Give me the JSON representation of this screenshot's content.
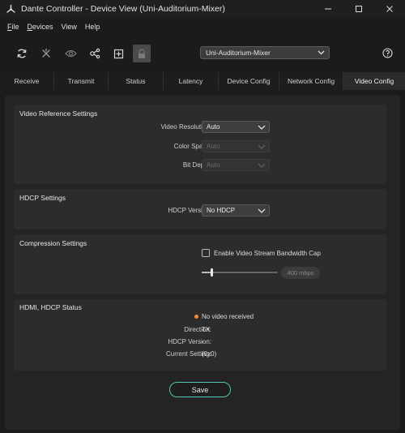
{
  "window": {
    "title": "Dante Controller - Device View (Uni-Auditorium-Mixer)",
    "icons": {
      "logo": "dante-logo-icon",
      "minimize": "minimize-icon",
      "maximize": "maximize-icon",
      "close": "close-icon"
    }
  },
  "menu": [
    {
      "underline": "F",
      "rest": "ile"
    },
    {
      "underline": "D",
      "rest": "evices"
    },
    {
      "underline": "",
      "rest": "View"
    },
    {
      "underline": "",
      "rest": "Help"
    }
  ],
  "toolbar": {
    "icons": [
      "refresh-icon",
      "disconnect-icon",
      "identify-eye-icon",
      "routing-nodes-icon",
      "add-box-icon",
      "lock-icon"
    ],
    "device_select": "Uni-Auditorium-Mixer",
    "help_icon": "help-icon"
  },
  "tabs": [
    "Receive",
    "Transmit",
    "Status",
    "Latency",
    "Device Config",
    "Network Config",
    "Video Config"
  ],
  "active_tab": "Video Config",
  "video_reference": {
    "title": "Video Reference Settings",
    "resolution_label": "Video Resolution:",
    "resolution_value": "Auto",
    "color_space_label": "Color Space:",
    "color_space_value": "Auto",
    "bit_depth_label": "Bit Depth:",
    "bit_depth_value": "Auto"
  },
  "hdcp": {
    "title": "HDCP Settings",
    "version_label": "HDCP Version:",
    "version_value": "No HDCP"
  },
  "compression": {
    "title": "Compression Settings",
    "checkbox_label": "Enable Video Stream Bandwidth Cap",
    "checked": false,
    "bandwidth_value": "400 mbps",
    "slider_fraction": 0.13
  },
  "status": {
    "title": "HDMI, HDCP Status",
    "video_state": "No video received",
    "direction_label": "Direction:",
    "direction_value": "TX",
    "hdcp_version_label": "HDCP Version:",
    "hdcp_version_value": "-",
    "current_setting_label": "Current Setting:",
    "current_setting_value": "(0x0)"
  },
  "save_label": "Save",
  "colors": {
    "accent": "#4ec8b0",
    "status_dot": "#f08a3c",
    "background": "#1b1b1b"
  }
}
